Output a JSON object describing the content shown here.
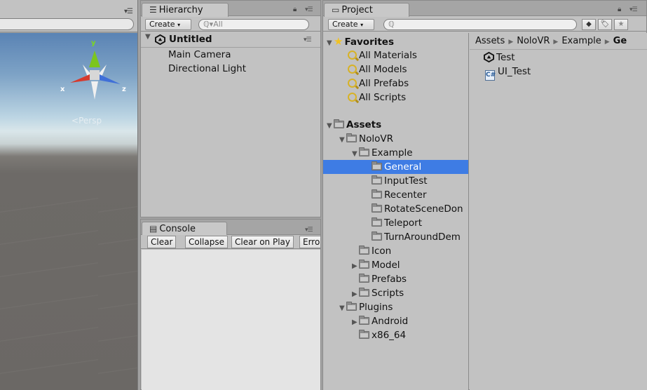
{
  "scene": {
    "gizmo": {
      "y_label": "y",
      "x_label": "x",
      "z_label": "z"
    },
    "persp_label": "Persp"
  },
  "hierarchy": {
    "tab_label": "Hierarchy",
    "create_label": "Create",
    "search_placeholder": "All",
    "scene_name": "Untitled",
    "items": [
      "Main Camera",
      "Directional Light"
    ]
  },
  "console": {
    "tab_label": "Console",
    "buttons": {
      "clear": "Clear",
      "collapse": "Collapse",
      "clear_on_play": "Clear on Play",
      "error_pause": "Erro"
    }
  },
  "project": {
    "tab_label": "Project",
    "create_label": "Create",
    "favorites": {
      "label": "Favorites",
      "items": [
        "All Materials",
        "All Models",
        "All Prefabs",
        "All Scripts"
      ]
    },
    "tree": {
      "assets": "Assets",
      "nolovr": "NoloVR",
      "example": "Example",
      "general": "General",
      "inputtest": "InputTest",
      "recenter": "Recenter",
      "rotatescene": "RotateSceneDon",
      "teleport": "Teleport",
      "turnaround": "TurnAroundDem",
      "icon": "Icon",
      "model": "Model",
      "prefabs": "Prefabs",
      "scripts": "Scripts",
      "plugins": "Plugins",
      "android": "Android",
      "x86_64": "x86_64"
    },
    "breadcrumb": [
      "Assets",
      "NoloVR",
      "Example",
      "Ge"
    ],
    "files": [
      "Test",
      "UI_Test"
    ]
  }
}
